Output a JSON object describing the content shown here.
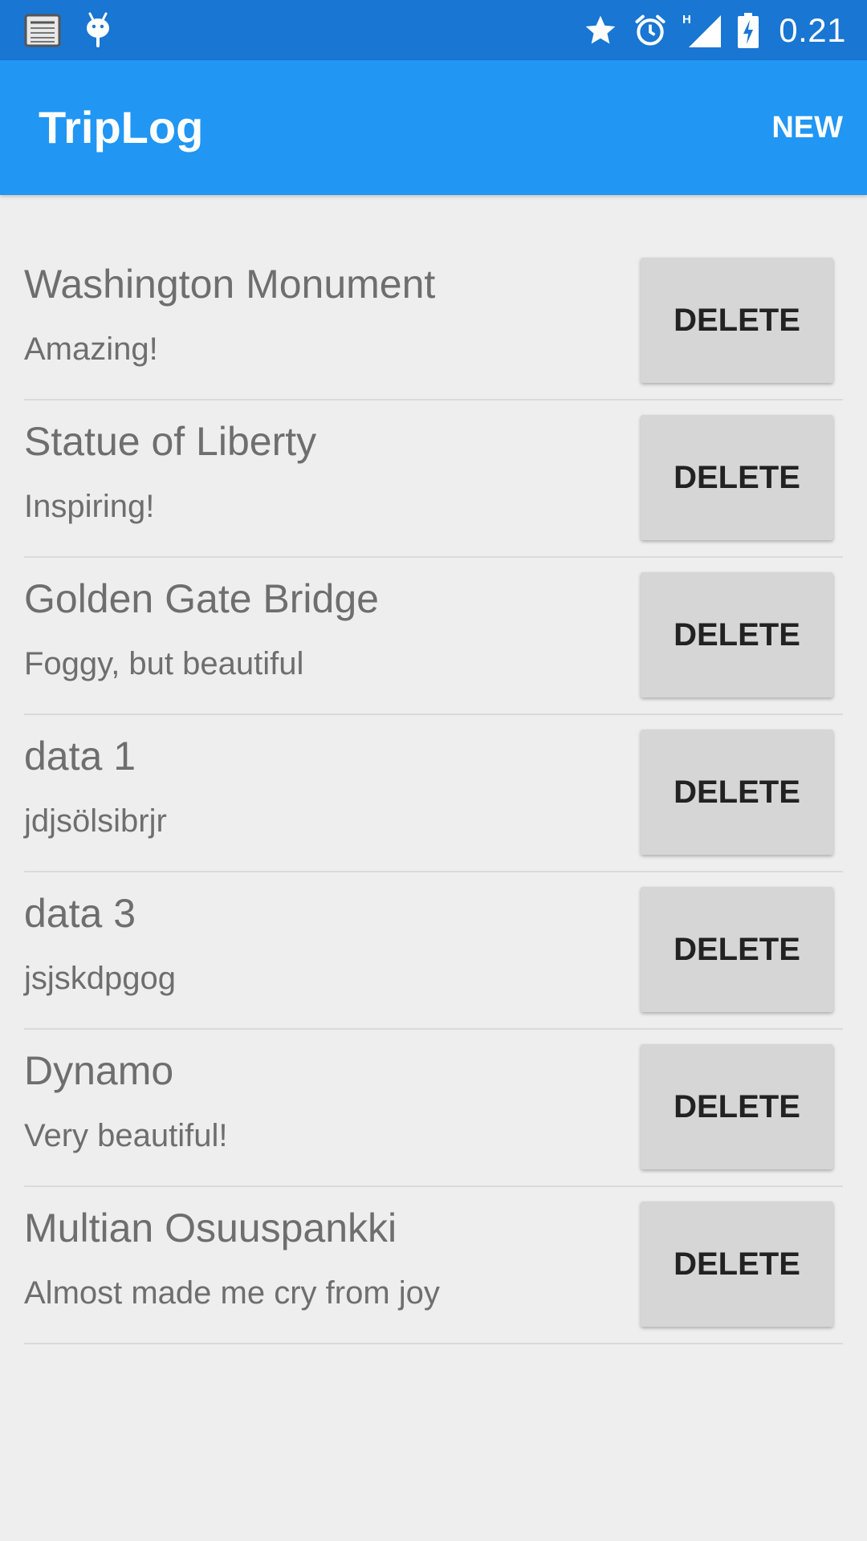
{
  "status_bar": {
    "time": "0.21",
    "network_badge": "H",
    "icons": [
      "notification-list-icon",
      "android-debug-icon",
      "star-icon",
      "alarm-icon",
      "signal-icon",
      "battery-charging-icon"
    ]
  },
  "app_bar": {
    "title": "TripLog",
    "action_label": "NEW"
  },
  "colors": {
    "status_bar": "#1976d2",
    "app_bar": "#2196f3",
    "background": "#eeeeee",
    "button": "#d6d6d6"
  },
  "entries": [
    {
      "title": "Washington Monument",
      "notes": "Amazing!",
      "button_label": "DELETE"
    },
    {
      "title": "Statue of Liberty",
      "notes": "Inspiring!",
      "button_label": "DELETE"
    },
    {
      "title": "Golden Gate Bridge",
      "notes": "Foggy, but beautiful",
      "button_label": "DELETE"
    },
    {
      "title": "data 1",
      "notes": "jdjsölsibrjr",
      "button_label": "DELETE"
    },
    {
      "title": "data 3",
      "notes": "jsjskdpgog",
      "button_label": "DELETE"
    },
    {
      "title": "Dynamo",
      "notes": "Very beautiful!",
      "button_label": "DELETE"
    },
    {
      "title": "Multian Osuuspankki",
      "notes": "Almost made me cry from joy",
      "button_label": "DELETE"
    }
  ]
}
